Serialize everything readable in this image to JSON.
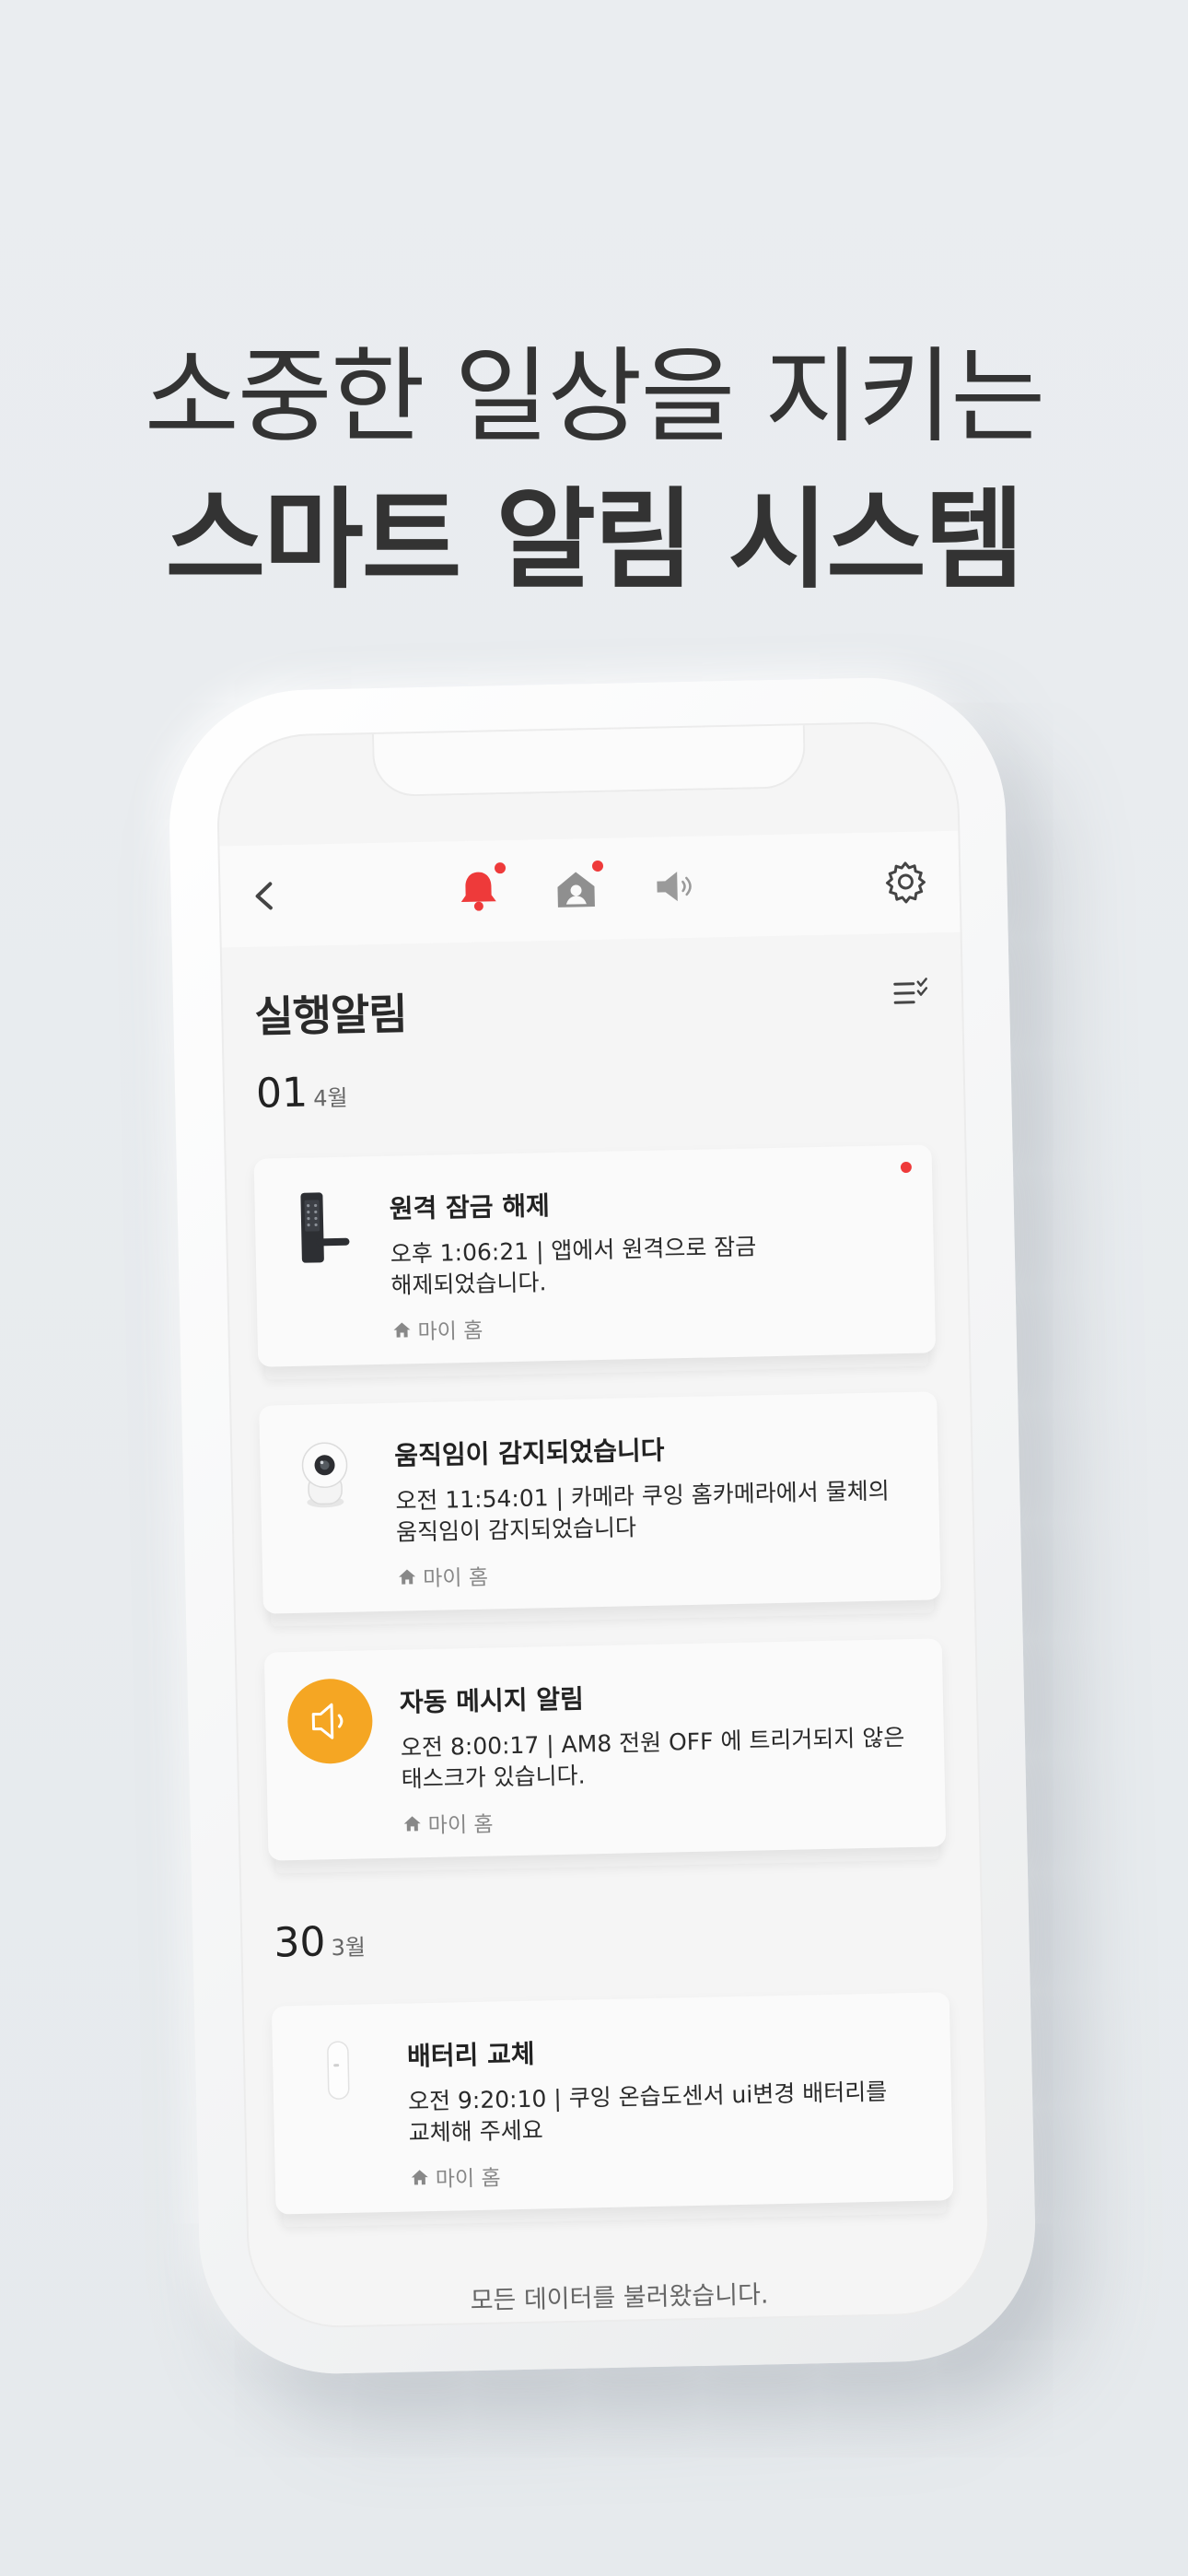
{
  "hero": {
    "line1": "소중한 일상을 지키는",
    "line2": "스마트 알림 시스템"
  },
  "topbar": {
    "tabs": [
      {
        "icon": "bell-icon",
        "active": true,
        "has_badge": true
      },
      {
        "icon": "home-user-icon",
        "active": false,
        "has_badge": true
      },
      {
        "icon": "speaker-icon",
        "active": false,
        "has_badge": false
      }
    ],
    "accent": "#ee3a3a"
  },
  "page": {
    "title": "실행알림"
  },
  "groups": [
    {
      "day": "01",
      "month": "4월",
      "items": [
        {
          "icon": "door-lock-icon",
          "title": "원격 잠금 해제",
          "body": "오후 1:06:21 | 앱에서 원격으로 잠금 해제되었습니다.",
          "location": "마이 홈",
          "unread": true
        },
        {
          "icon": "camera-icon",
          "title": "움직임이 감지되었습니다",
          "body": "오전 11:54:01 | 카메라 쿠잉 홈카메라에서 물체의 움직임이 감지되었습니다",
          "location": "마이 홈",
          "unread": false
        },
        {
          "icon": "speaker-icon",
          "title": "자동 메시지 알림",
          "body": "오전 8:00:17 | AM8 전원 OFF 에 트리거되지 않은 태스크가 있습니다.",
          "location": "마이 홈",
          "unread": false
        }
      ]
    },
    {
      "day": "30",
      "month": "3월",
      "items": [
        {
          "icon": "sensor-icon",
          "title": "배터리 교체",
          "body": "오전 9:20:10 | 쿠잉 온습도센서 ui변경 배터리를 교체해 주세요",
          "location": "마이 홈",
          "unread": false
        }
      ]
    }
  ],
  "footer": {
    "text": "모든 데이터를 불러왔습니다."
  }
}
